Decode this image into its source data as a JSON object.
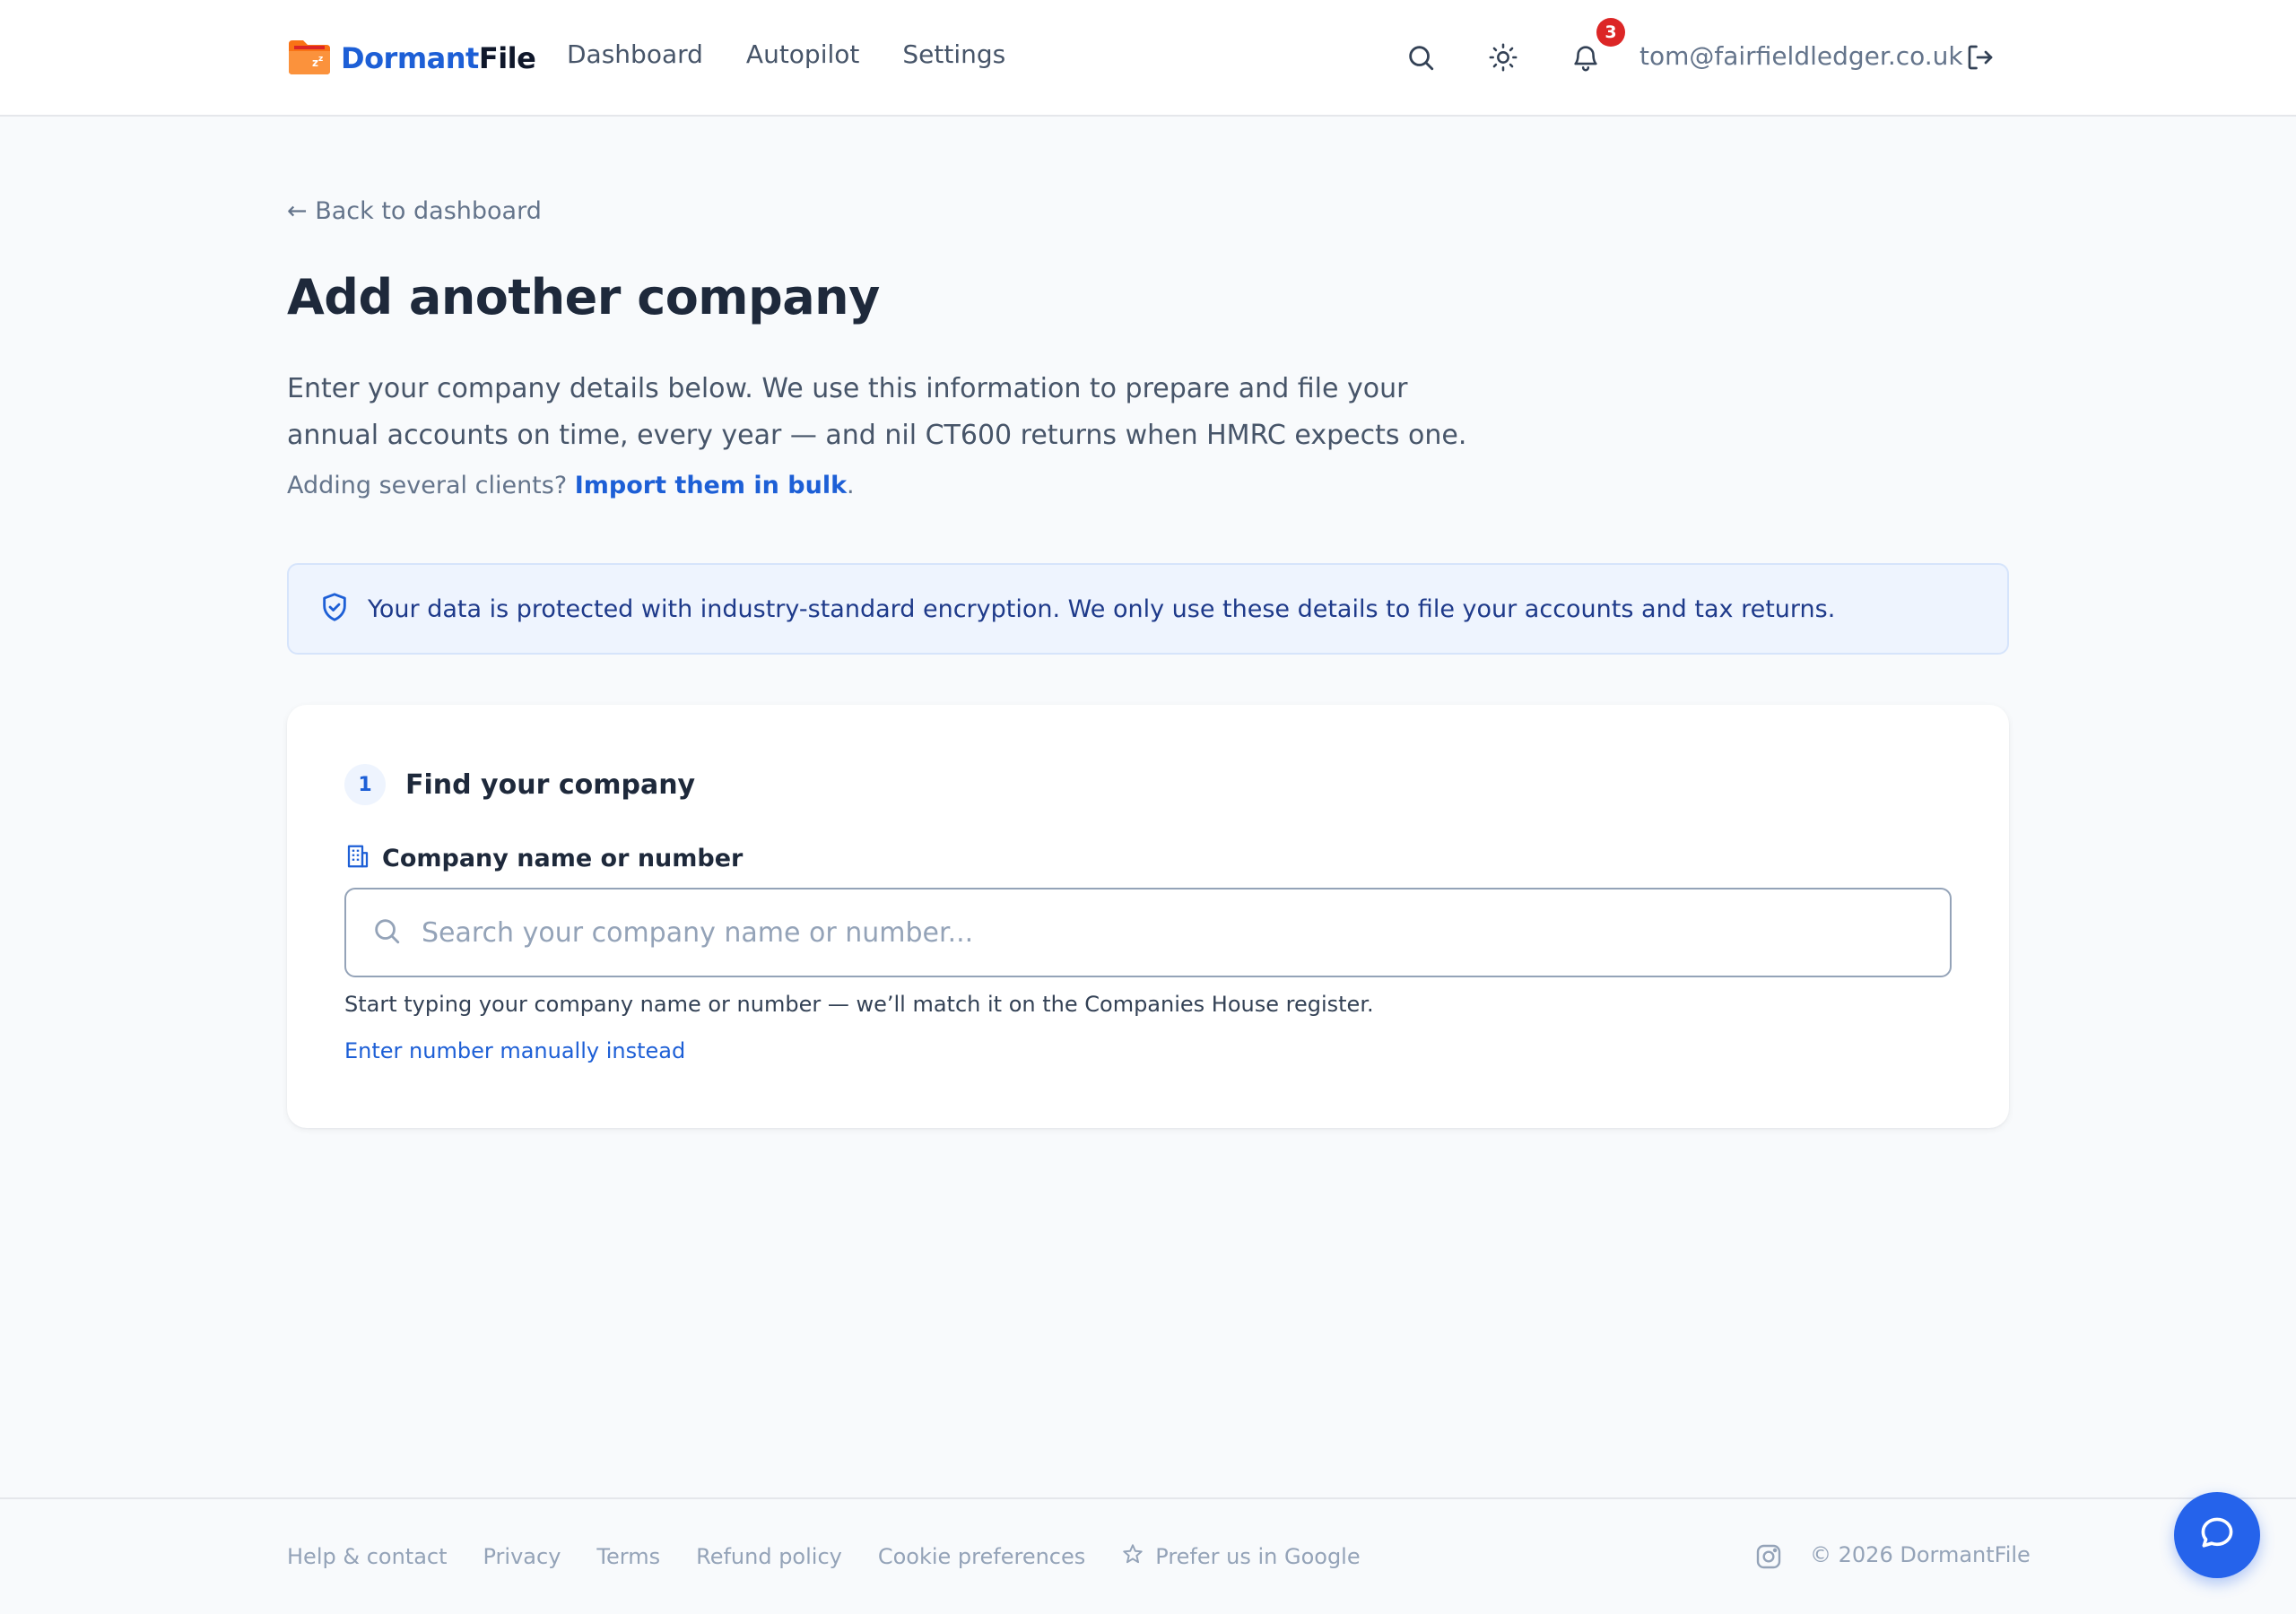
{
  "header": {
    "brand_part1": "Dormant",
    "brand_part2": "File",
    "nav": [
      {
        "label": "Dashboard"
      },
      {
        "label": "Autopilot"
      },
      {
        "label": "Settings"
      }
    ],
    "notification_count": "3",
    "user_email": "tom@fairfieldledger.co.uk",
    "icons": [
      "search-icon",
      "theme-toggle-icon",
      "bell-icon",
      "logout-icon"
    ]
  },
  "main": {
    "back_link": "← Back to dashboard",
    "title": "Add another company",
    "intro": "Enter your company details below. We use this information to prepare and file your annual accounts on time, every year — and nil CT600 returns when HMRC expects one.",
    "bulk_prefix": "Adding several clients? ",
    "bulk_link": "Import them in bulk",
    "bulk_suffix": ".",
    "notice": "Your data is protected with industry-standard encryption. We only use these details to file your accounts and tax returns."
  },
  "card": {
    "step_number": "1",
    "step_title": "Find your company",
    "field_label": "Company name or number",
    "search_placeholder": "Search your company name or number...",
    "search_value": "",
    "help_text": "Start typing your company name or number — we’ll match it on the Companies House register.",
    "manual_link": "Enter number manually instead"
  },
  "footer": {
    "links": [
      {
        "label": "Help & contact"
      },
      {
        "label": "Privacy"
      },
      {
        "label": "Terms"
      },
      {
        "label": "Refund policy"
      },
      {
        "label": "Cookie preferences"
      }
    ],
    "prefer_google": "Prefer us in Google",
    "copyright": "© 2026 DormantFile"
  },
  "colors": {
    "brand_blue": "#1d5fd6",
    "logo_orange": "#f97316",
    "badge_red": "#dc2626",
    "chat_blue": "#2563eb"
  }
}
